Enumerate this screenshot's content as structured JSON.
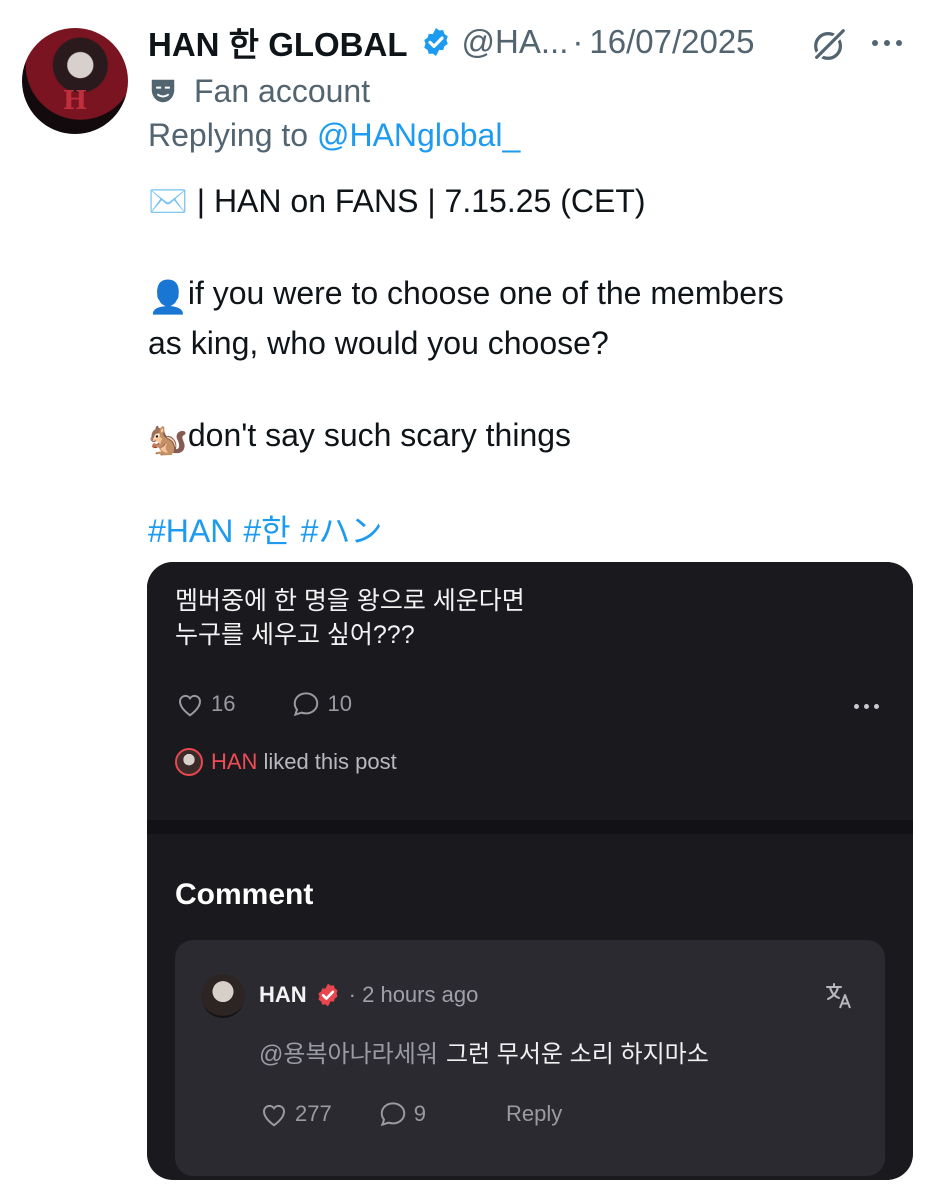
{
  "author": {
    "display_name": "HAN 한 GLOBAL",
    "handle": "@HA...",
    "separator": "·",
    "date": "16/07/2025",
    "label": "Fan account",
    "replying_prefix": "Replying to",
    "replying_to": "@HANglobal_"
  },
  "tweet": {
    "line1": "✉️ | HAN on FANS | 7.15.25 (CET)",
    "question_emoji": "👤",
    "question_line1": "if you were to choose one of the members",
    "question_line2": "as king, who would you choose?",
    "answer_emoji": "🐿️",
    "answer": "don't say such scary things",
    "hashtags": [
      "#HAN",
      "#한",
      "#ハン"
    ]
  },
  "card": {
    "post_line1": "멤버중에 한 명을 왕으로 세운다면",
    "post_line2": "누구를 세우고 싶어???",
    "likes": "16",
    "comments": "10",
    "liked_name": "HAN",
    "liked_suffix": "liked this post",
    "comment_heading": "Comment",
    "comment": {
      "name": "HAN",
      "time": "· 2 hours ago",
      "mention": "@용복아나라세워",
      "text": "그런 무서운 소리 하지마소",
      "likes": "277",
      "replies": "9",
      "reply_label": "Reply"
    }
  },
  "colors": {
    "link": "#1d9bf0",
    "card_bg": "#1a191e",
    "comment_bg": "#2a2a30",
    "accent_red": "#ef4c56"
  }
}
